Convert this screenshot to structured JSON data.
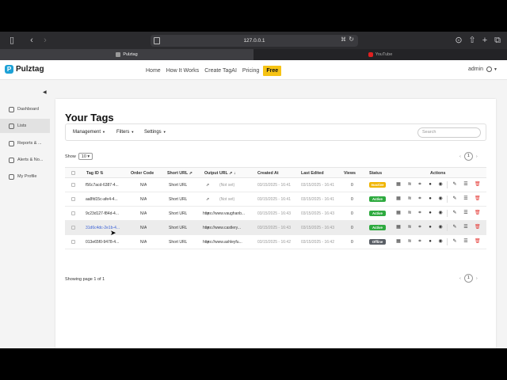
{
  "browser": {
    "url": "127.0.0.1",
    "tabs": [
      {
        "title": "Pulztag"
      },
      {
        "title": "YouTube"
      }
    ]
  },
  "nav": {
    "brand": "Pulztag",
    "links": [
      "Home",
      "How It Works",
      "Create TagAI",
      "Pricing"
    ],
    "free": "Free",
    "user": "admin"
  },
  "sidebar": {
    "items": [
      {
        "label": "Dashboard",
        "icon": "gauge-icon"
      },
      {
        "label": "Lists",
        "icon": "list-icon"
      },
      {
        "label": "Reports & ...",
        "icon": "chart-icon"
      },
      {
        "label": "Alerts & No...",
        "icon": "bell-icon"
      },
      {
        "label": "My Profile",
        "icon": "user-icon"
      }
    ]
  },
  "page": {
    "title": "Your Tags",
    "menus": [
      "Management",
      "Filters",
      "Settings"
    ],
    "search_placeholder": "Search",
    "show_label": "Show",
    "page_size": "10",
    "page_number": "1",
    "showing": "Showing page 1 of 1"
  },
  "table": {
    "headers": [
      "Tag ID",
      "Order Code",
      "Short URL",
      "Output URL",
      "Created At",
      "Last Edited",
      "Views",
      "Status",
      "Actions"
    ],
    "rows": [
      {
        "tag_id": "f56c7acd-6387-4...",
        "order": "N/A",
        "short": "Short URL",
        "output": "(Not set)",
        "created": "03/15/2025 - 16:41",
        "edited": "03/15/2025 - 16:41",
        "views": "0",
        "status": "Inactive"
      },
      {
        "tag_id": "aa8fd15c-afe4-4...",
        "order": "N/A",
        "short": "Short URL",
        "output": "(Not set)",
        "created": "03/15/2025 - 16:41",
        "edited": "03/15/2025 - 16:41",
        "views": "0",
        "status": "Active"
      },
      {
        "tag_id": "9c23d127-f84d-4...",
        "order": "N/A",
        "short": "Short URL",
        "output": "https://www.vaughanb...",
        "created": "03/15/2025 - 16:43",
        "edited": "03/15/2025 - 16:43",
        "views": "0",
        "status": "Active"
      },
      {
        "tag_id": "31d6c4dc-2e1b-4...",
        "order": "N/A",
        "short": "Short URL",
        "output": "https://www.castlery...",
        "created": "03/15/2025 - 16:43",
        "edited": "03/15/2025 - 16:43",
        "views": "0",
        "status": "Active"
      },
      {
        "tag_id": "013e65f0-9478-4...",
        "order": "N/A",
        "short": "Short URL",
        "output": "https://www.ashleyfu...",
        "created": "03/15/2025 - 16:42",
        "edited": "03/15/2025 - 16:42",
        "views": "0",
        "status": "Offline"
      }
    ]
  },
  "colors": {
    "accent": "#1da1d6",
    "free": "#f6c314",
    "active": "#2eaa3f",
    "inactive": "#f0b400",
    "offline": "#5a5f66",
    "delete": "#e53935"
  }
}
